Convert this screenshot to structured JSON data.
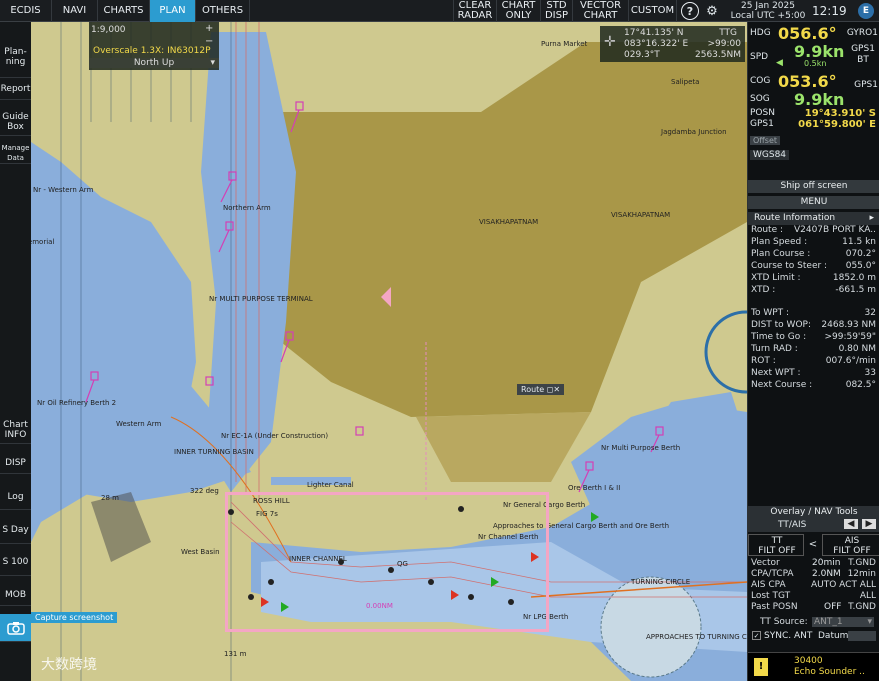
{
  "topbar": {
    "tabs": [
      "ECDIS",
      "NAVI",
      "CHARTS",
      "PLAN",
      "OTHERS"
    ],
    "active_tab": "PLAN",
    "actions": [
      "CLEAR RADAR",
      "CHART ONLY",
      "STD DISP",
      "VECTOR CHART",
      "CUSTOM"
    ],
    "date": "25 Jan 2025",
    "tz": "Local UTC +5:00",
    "time": "12:19",
    "e_label": "E"
  },
  "leftbar": {
    "items": [
      "Plan-ning",
      "Report",
      "Guide Box",
      "Manage Data",
      "Chart INFO",
      "DISP",
      "Log",
      "S Day",
      "S 100",
      "MOB"
    ],
    "capture": "Capture screenshot"
  },
  "chart": {
    "scale": "1:9,000",
    "overscale": "Overscale 1.3X: IN63012P",
    "orientation": "North Up",
    "cursor_lat": "17°41.135' N",
    "cursor_lon": "083°16.322' E",
    "ttg_label": "TTG",
    "ttg": ">99:00",
    "brg": "029.3°T",
    "dist": "2563.5NM",
    "route_tag": "Route",
    "labels": {
      "purna": "Purna Market",
      "salipeta": "Salipeta",
      "jagadamba": "Jagdamba Junction",
      "visakha1": "VISAKHAPATNAM",
      "visakha2": "VISAKHAPATNAM",
      "western_arm": "Nr - Western Arm",
      "war_memorial": "War Memorial",
      "northern_arm": "Northern Arm",
      "multipurpose": "Nr MULTI PURPOSE TERMINAL",
      "western_arm2": "Western Arm",
      "oil_refinery": "Nr Oil Refinery Berth 2",
      "inner_turning": "INNER TURNING BASIN",
      "ec1a": "Nr EC-1A (Under Construction)",
      "lighter_canal": "Lighter Canal",
      "ross_hill": "ROSS HILL",
      "inner_channel": "INNER CHANNEL",
      "general_cargo": "Nr General Cargo Berth",
      "approaches_gc": "Approaches to General Cargo Berth and Ore Berth",
      "turning_circle": "TURNING CIRCLE",
      "approaches_tc": "APPROACHES TO TURNING CI",
      "multi_berth": "Nr Multi Purpose Berth",
      "ore_berth": "Ore Berth I & II",
      "lpg_berth": "Nr LPG Berth",
      "fig7s": "FIG 7s",
      "qg": "QG",
      "dist_label": "322 deg",
      "m28": "28 m",
      "m131": "131 m",
      "nm": "0.00NM",
      "channel_berth": "Nr Channel Berth",
      "west_basin": "West Basin"
    }
  },
  "right": {
    "hdg_label": "HDG",
    "hdg": "056.6°",
    "hdg_src": "GYRO1",
    "spd_label": "SPD",
    "spd": "9.9kn",
    "spd_sub": "0.5kn",
    "spd_src": "GPS1 BT",
    "cog_label": "COG",
    "cog": "053.6°",
    "cog_src": "GPS1",
    "sog_label": "SOG",
    "sog": "9.9kn",
    "posn_label": "POSN",
    "posn_src": "GPS1",
    "lat": "19°43.910' S",
    "lon": "061°59.800' E",
    "offset": "Offset",
    "datum": "WGS84",
    "ship_off": "Ship off screen",
    "menu": "MENU",
    "route_info": "Route Information",
    "route_rows": [
      {
        "k": "Route :",
        "v": "V2407B PORT KA.."
      },
      {
        "k": "Plan Speed :",
        "v": "11.5 kn"
      },
      {
        "k": "Plan Course :",
        "v": "070.2°"
      },
      {
        "k": "Course to Steer :",
        "v": "055.0°"
      },
      {
        "k": "XTD Limit :",
        "v": "1852.0 m"
      },
      {
        "k": "XTD :",
        "v": "-661.5 m"
      },
      {
        "k": "To WPT :",
        "v": "32"
      },
      {
        "k": "DIST to WOP:",
        "v": "2468.93 NM"
      },
      {
        "k": "Time to Go :",
        "v": ">99:59'59\""
      },
      {
        "k": "Turn RAD :",
        "v": "0.80 NM"
      },
      {
        "k": "ROT :",
        "v": "007.6°/min"
      },
      {
        "k": "Next WPT :",
        "v": "33"
      },
      {
        "k": "Next Course :",
        "v": "082.5°"
      }
    ],
    "overlay_title": "Overlay / NAV Tools",
    "ttais": "TT/AIS",
    "tt": "TT",
    "tt_state": "FILT OFF",
    "ais": "AIS",
    "ais_state": "FILT OFF",
    "vector": "Vector",
    "vector_v1": "20min",
    "vector_v2": "T.GND",
    "cpa": "CPA/TCPA",
    "cpa_v1": "2.0NM",
    "cpa_v2": "12min",
    "aiscpa": "AIS CPA",
    "aiscpa_v": "AUTO ACT ALL",
    "lost": "Lost TGT",
    "lost_v": "ALL",
    "past": "Past POSN",
    "past_v1": "OFF",
    "past_v2": "T.GND",
    "tt_source": "TT Source:",
    "tt_source_v": "ANT_1",
    "sync": "SYNC. ANT",
    "datum_lbl": "Datum:",
    "alert_code": "30400",
    "alert_text": "Echo Sounder ..",
    "alert_icon": "!"
  },
  "colors": {
    "land": "#cfc98f",
    "land_dark": "#a99748",
    "water": "#8aaedb",
    "water_deep": "#a9c6e8",
    "active_tab": "#2c9cd0",
    "highlight": "#f4a6c4",
    "magenta": "#d43fb5"
  },
  "watermark": "大数跨境"
}
